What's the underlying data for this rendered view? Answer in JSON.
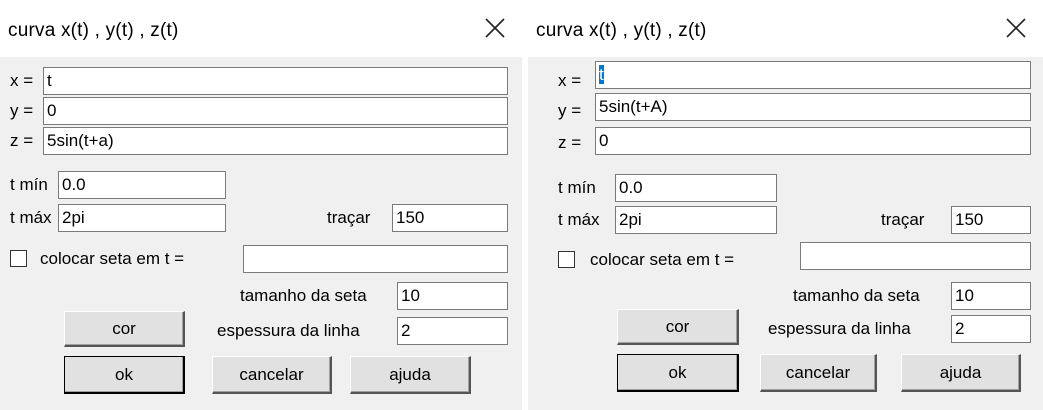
{
  "dialogs": [
    {
      "title": "curva x(t) , y(t) , z(t)",
      "x_label": "x =",
      "x_value": "t",
      "y_label": "y =",
      "y_value": "0",
      "z_label": "z =",
      "z_value": "5sin(t+a)",
      "tmin_label": "t mín",
      "tmin_value": "0.0",
      "tmax_label": "t máx",
      "tmax_value": "2pi",
      "tracar_label": "traçar",
      "tracar_value": "150",
      "seta_checkbox_label": "colocar seta em t =",
      "seta_checked": false,
      "seta_value": "",
      "tamanho_label": "tamanho da seta",
      "tamanho_value": "10",
      "espessura_label": "espessura da linha",
      "espessura_value": "2",
      "cor_button": "cor",
      "ok_button": "ok",
      "cancelar_button": "cancelar",
      "ajuda_button": "ajuda",
      "close_icon": "close-icon"
    },
    {
      "title": "curva x(t) , y(t) , z(t)",
      "x_label": "x =",
      "x_value": "t",
      "x_selected": true,
      "y_label": "y =",
      "y_value": "5sin(t+A)",
      "z_label": "z =",
      "z_value": "0",
      "tmin_label": "t mín",
      "tmin_value": "0.0",
      "tmax_label": "t máx",
      "tmax_value": "2pi",
      "tracar_label": "traçar",
      "tracar_value": "150",
      "seta_checkbox_label": "colocar seta em t =",
      "seta_checked": false,
      "seta_value": "",
      "tamanho_label": "tamanho da seta",
      "tamanho_value": "10",
      "espessura_label": "espessura da linha",
      "espessura_value": "2",
      "cor_button": "cor",
      "ok_button": "ok",
      "cancelar_button": "cancelar",
      "ajuda_button": "ajuda",
      "close_icon": "close-icon"
    }
  ]
}
